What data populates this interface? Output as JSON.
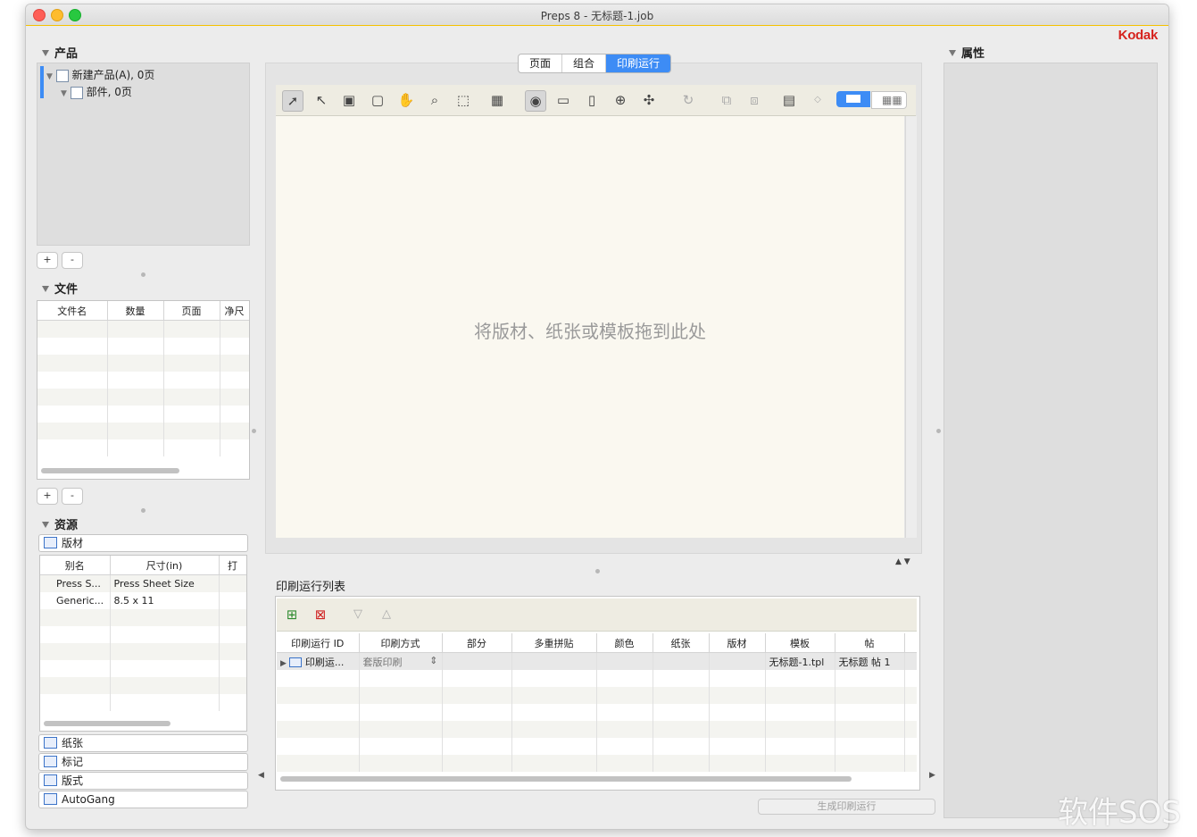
{
  "window": {
    "title": "Preps 8 - 无标题-1.job",
    "brand": "Kodak"
  },
  "products": {
    "title": "产品",
    "tree": [
      {
        "label": "新建产品(A), 0页"
      },
      {
        "label": "部件, 0页"
      }
    ],
    "add_label": "+",
    "remove_label": "-"
  },
  "files": {
    "title": "文件",
    "columns": [
      "文件名",
      "数量",
      "页面",
      "净尺"
    ],
    "add_label": "+",
    "remove_label": "-"
  },
  "resources": {
    "title": "资源",
    "active_tab": "版材",
    "columns": [
      "别名",
      "尺寸(in)",
      "打"
    ],
    "rows": [
      [
        "Press S...",
        "Press Sheet Size"
      ],
      [
        "Generic...",
        "8.5 x 11"
      ]
    ],
    "tabs": [
      "纸张",
      "标记",
      "版式",
      "AutoGang"
    ]
  },
  "view_tabs": [
    "页面",
    "组合",
    "印刷运行"
  ],
  "active_view_tab": "印刷运行",
  "canvas": {
    "drop_message": "将版材、纸张或模板拖到此处"
  },
  "runs": {
    "title": "印刷运行列表",
    "columns": [
      "印刷运行 ID",
      "印刷方式",
      "部分",
      "多重拼贴",
      "颜色",
      "纸张",
      "版材",
      "模板",
      "帖"
    ],
    "rows": [
      [
        "印刷运...",
        "套版印刷",
        "",
        "",
        "",
        "",
        "",
        "无标题-1.tpl",
        "无标题 帖 1"
      ]
    ],
    "generate_button": "生成印刷运行"
  },
  "properties": {
    "title": "属性"
  },
  "watermark": "软件SOS",
  "colors": {
    "accent": "#3d8cf5",
    "brand": "#d6231e",
    "canvas": "#faf8f0"
  }
}
